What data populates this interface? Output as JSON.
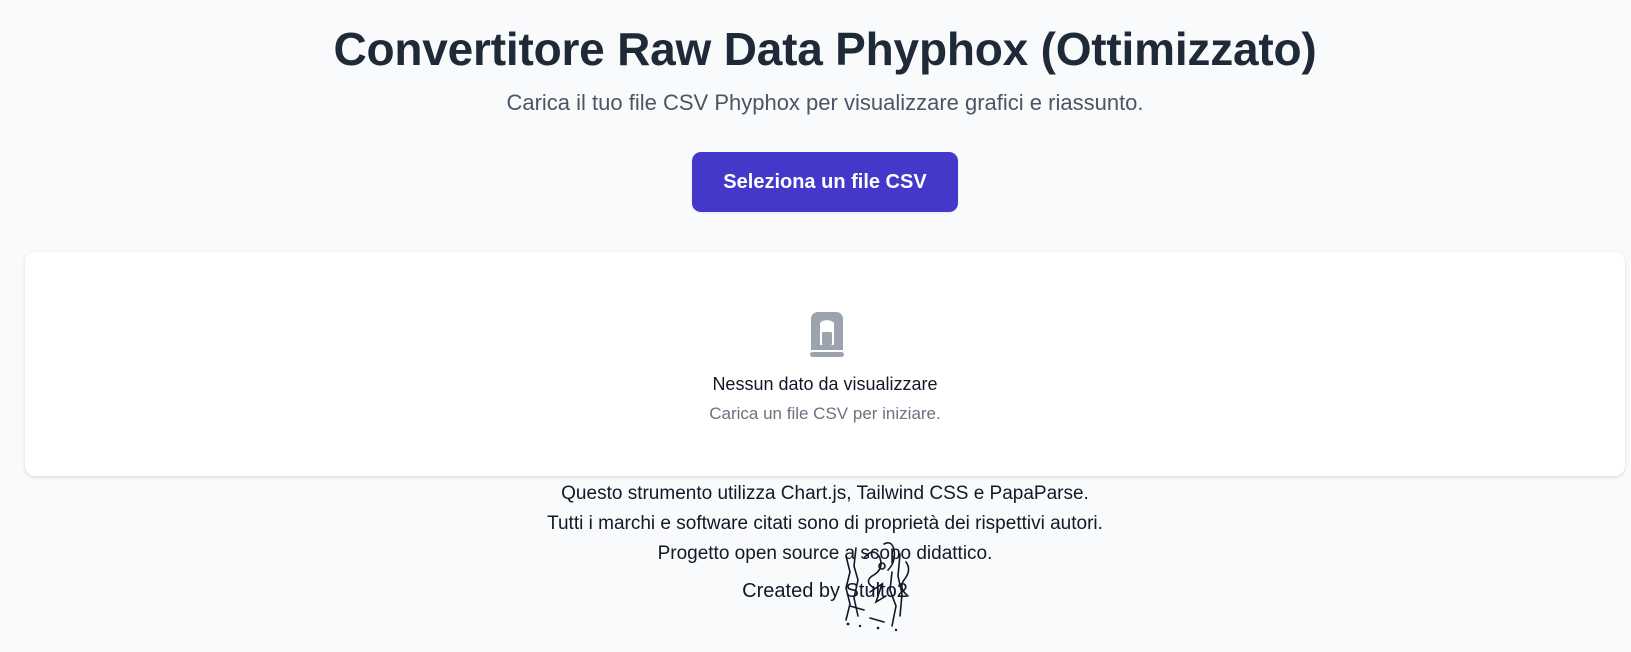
{
  "header": {
    "title": "Convertitore Raw Data Phyphox (Ottimizzato)",
    "subtitle": "Carica il tuo file CSV Phyphox per visualizzare grafici e riassunto."
  },
  "upload": {
    "button_label": "Seleziona un file CSV"
  },
  "empty_state": {
    "icon": "document-lock-icon",
    "title": "Nessun dato da visualizzare",
    "hint": "Carica un file CSV per iniziare."
  },
  "footer": {
    "lines": [
      "Questo strumento utilizza Chart.js, Tailwind CSS e PapaParse.",
      "Tutti i marchi e software citati sono di proprietà dei rispettivi autori.",
      "Progetto open source a scopo didattico."
    ],
    "credit": "Created by Stulto2"
  },
  "colors": {
    "background": "#f8fafc",
    "primary_button": "#4338ca",
    "card": "#ffffff",
    "icon": "#9ca3af"
  }
}
